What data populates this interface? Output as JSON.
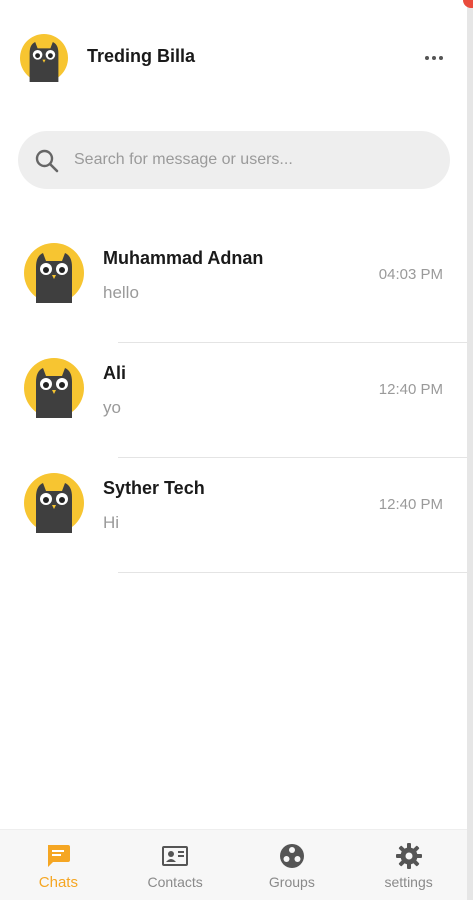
{
  "header": {
    "title": "Treding Billa",
    "more_icon": "more-horizontal-icon"
  },
  "search": {
    "placeholder": "Search for message or users...",
    "value": "",
    "icon": "search-icon"
  },
  "chats": [
    {
      "name": "Muhammad Adnan",
      "message": "hello",
      "time": "04:03 PM"
    },
    {
      "name": "Ali",
      "message": "yo",
      "time": "12:40 PM"
    },
    {
      "name": "Syther Tech",
      "message": "Hi",
      "time": "12:40 PM"
    }
  ],
  "nav": [
    {
      "label": "Chats",
      "icon": "chat-icon",
      "active": true
    },
    {
      "label": "Contacts",
      "icon": "contact-card-icon",
      "active": false
    },
    {
      "label": "Groups",
      "icon": "groups-icon",
      "active": false
    },
    {
      "label": "settings",
      "icon": "gear-icon",
      "active": false
    }
  ],
  "colors": {
    "accent": "#f5a623",
    "avatar_bg": "#f7c531",
    "avatar_owl": "#3f3f3f",
    "search_bg": "#eeeeee",
    "muted_text": "#9a9a9a"
  }
}
